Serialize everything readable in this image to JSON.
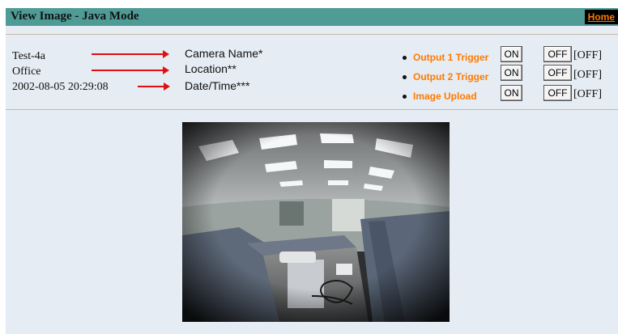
{
  "header": {
    "title": "View Image - Java Mode",
    "home_label": "Home"
  },
  "info": {
    "camera_name": "Test-4a",
    "location": "Office",
    "datetime": "2002-08-05 20:29:08"
  },
  "labels": {
    "camera_name": "Camera Name*",
    "location": "Location**",
    "datetime": "Date/Time***"
  },
  "controls": [
    {
      "label": "Output 1 Trigger",
      "on": "ON",
      "off": "OFF",
      "state": "[OFF]"
    },
    {
      "label": "Output 2 Trigger",
      "on": "ON",
      "off": "OFF",
      "state": "[OFF]"
    },
    {
      "label": "Image Upload",
      "on": "ON",
      "off": "OFF",
      "state": "[OFF]"
    }
  ],
  "colors": {
    "header_bg": "#4e9c95",
    "accent": "#ff7a00",
    "arrow": "#e01010",
    "panel_bg": "#e6ecf3"
  }
}
